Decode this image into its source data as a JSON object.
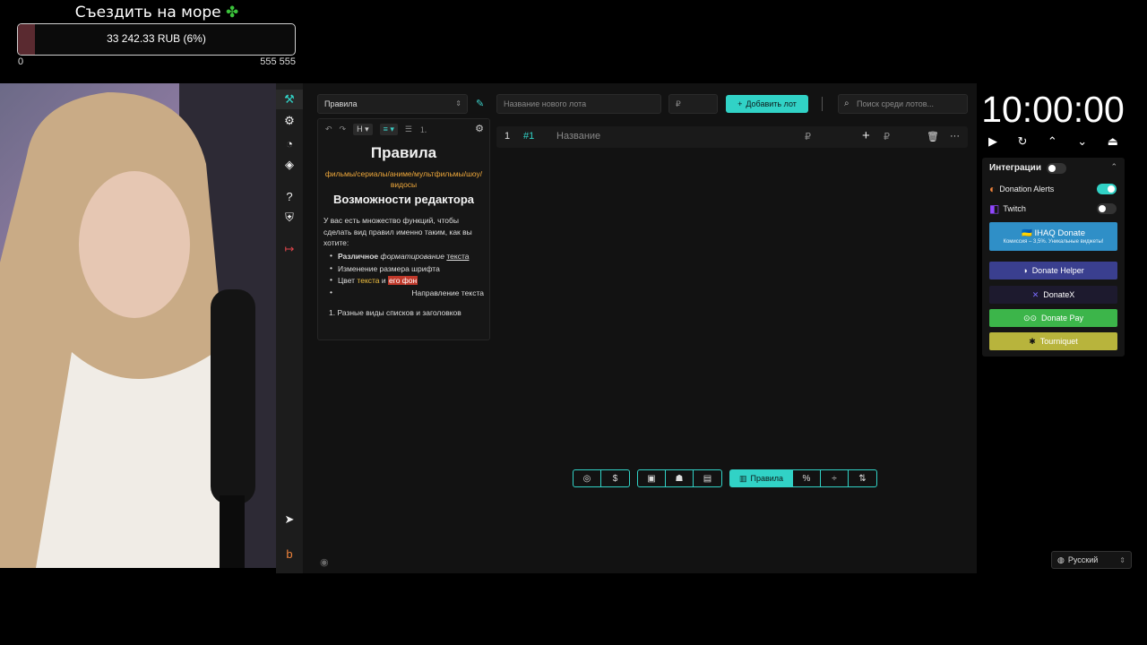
{
  "goal": {
    "title": "Съездить на море",
    "amount_label": "33 242.33 RUB (6%)",
    "progress_percent": 6,
    "min": "0",
    "max": "555 555"
  },
  "toolbar": {
    "rules_select": "Правила",
    "lot_name_placeholder": "Название нового лота",
    "lot_price_placeholder": "₽",
    "add_lot_label": "Добавить лот",
    "search_placeholder": "Поиск среди лотов..."
  },
  "editor": {
    "heading_btn": "H",
    "h1": "Правила",
    "subtitle": "фильмы/сериалы/аниме/мультфильмы/шоу/видосы",
    "h2": "Возможности редактора",
    "paragraph": "У вас есть множество функций, чтобы сделать вид правил именно таким, как вы хотите:",
    "bullets": {
      "b1_bold": "Различное",
      "b1_italic": "форматирование",
      "b1_underline": "текста",
      "b2": "Изменение размера шрифта",
      "b3_prefix": "Цвет",
      "b3_yellow": "текста",
      "b3_mid": "и",
      "b3_red": "его фон",
      "b4": "Направление текста"
    },
    "ordered_item": "1. Разные виды списков и заголовков"
  },
  "lot": {
    "index": "1",
    "tag": "#1",
    "name": "Название",
    "currency": "₽",
    "plus": "+",
    "currency2": "₽"
  },
  "bottom_bar": {
    "rules_label": "Правила"
  },
  "timer": {
    "display": "10:00:00"
  },
  "integrations": {
    "title": "Интеграции",
    "donation_alerts": "Donation Alerts",
    "twitch": "Twitch",
    "ihaq_title": "IHAQ Donate",
    "ihaq_sub": "Комиссия – 3,5%. Уникальные виджеты!",
    "donate_helper": "Donate Helper",
    "donatex": "DonateX",
    "donate_pay": "Donate Pay",
    "tourniquet": "Tourniquet"
  },
  "language": {
    "selected": "Русский"
  },
  "colors": {
    "accent": "#31d2c6",
    "goal_fill": "#5a2a30",
    "subtitle_orange": "#f0a93b"
  }
}
